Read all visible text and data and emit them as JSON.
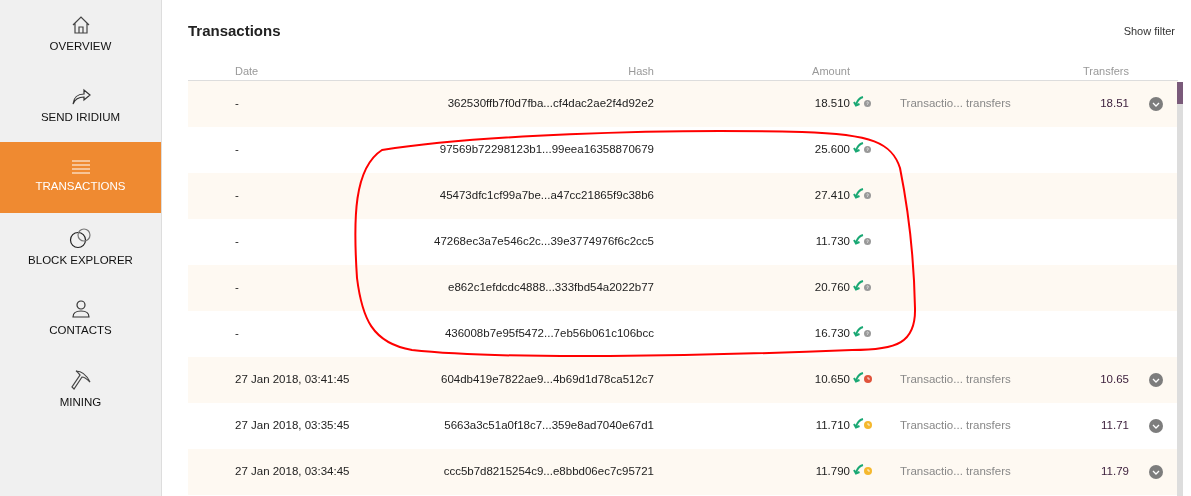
{
  "sidebar": {
    "items": [
      {
        "label": "OVERVIEW",
        "selected": false
      },
      {
        "label": "SEND IRIDIUM",
        "selected": false
      },
      {
        "label": "TRANSACTIONS",
        "selected": true
      },
      {
        "label": "BLOCK EXPLORER",
        "selected": false
      },
      {
        "label": "CONTACTS",
        "selected": false
      },
      {
        "label": "MINING",
        "selected": false
      }
    ]
  },
  "title": "Transactions",
  "show_filter": "Show filter",
  "table": {
    "columns": [
      "Date",
      "Hash",
      "Amount",
      "Transfers"
    ],
    "rows": [
      {
        "date": "-",
        "hash": "362530ffb7f0d7fba...cf4dac2ae2f4d92e2",
        "amount": "18.510",
        "kind": "unknown",
        "description": "Transactio... transfers",
        "transfers": "18.51"
      },
      {
        "date": "-",
        "hash": "97569b72298123b1...99eea16358870679",
        "amount": "25.600",
        "kind": "unknown"
      },
      {
        "date": "-",
        "hash": "45473dfc1cf99a7be...a47cc21865f9c38b6",
        "amount": "27.410",
        "kind": "unknown"
      },
      {
        "date": "-",
        "hash": "47268ec3a7e546c2c...39e3774976f6c2cc5",
        "amount": "11.730",
        "kind": "unknown"
      },
      {
        "date": "-",
        "hash": "e862c1efdcdc4888...333fbd54a2022b77",
        "amount": "20.760",
        "kind": "unknown"
      },
      {
        "date": "-",
        "hash": "436008b7e95f5472...7eb56b061c106bcc",
        "amount": "16.730",
        "kind": "unknown"
      },
      {
        "date": "27 Jan 2018, 03:41:45",
        "hash": "604db419e7822ae9...4b69d1d78ca512c7",
        "amount": "10.650",
        "kind": "failed",
        "description": "Transactio... transfers",
        "transfers": "10.65"
      },
      {
        "date": "27 Jan 2018, 03:35:45",
        "hash": "5663a3c51a0f18c7...359e8ad7040e67d1",
        "amount": "11.710",
        "kind": "pending",
        "description": "Transactio... transfers",
        "transfers": "11.71"
      },
      {
        "date": "27 Jan 2018, 03:34:45",
        "hash": "ccc5b7d8215254c9...e8bbd06ec7c95721",
        "amount": "11.790",
        "kind": "pending",
        "description": "Transactio... transfers",
        "transfers": "11.79"
      }
    ]
  }
}
